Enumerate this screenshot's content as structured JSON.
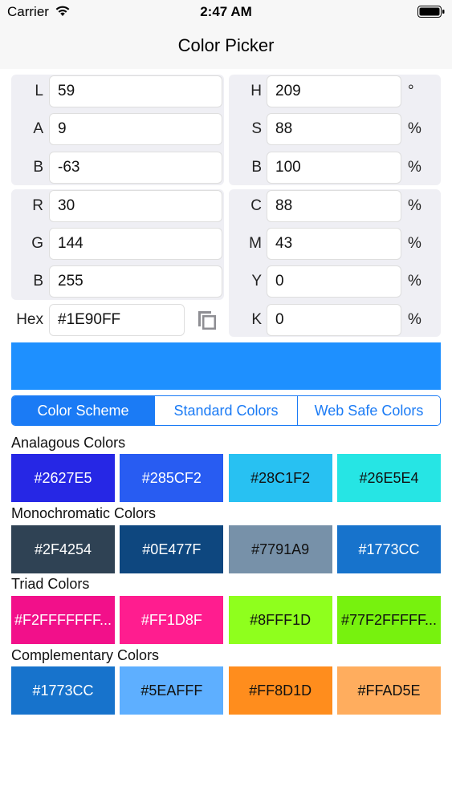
{
  "status_bar": {
    "carrier": "Carrier",
    "time": "2:47 AM"
  },
  "nav": {
    "title": "Color Picker"
  },
  "lab": {
    "l_label": "L",
    "l": "59",
    "a_label": "A",
    "a": "9",
    "b_label": "B",
    "b": "-63"
  },
  "hsb": {
    "h_label": "H",
    "h": "209",
    "h_unit": "°",
    "s_label": "S",
    "s": "88",
    "s_unit": "%",
    "b_label": "B",
    "b": "100",
    "b_unit": "%"
  },
  "rgb": {
    "r_label": "R",
    "r": "30",
    "g_label": "G",
    "g": "144",
    "b_label": "B",
    "b": "255",
    "hex_label": "Hex",
    "hex": "#1E90FF"
  },
  "cmyk": {
    "c_label": "C",
    "c": "88",
    "c_unit": "%",
    "m_label": "M",
    "m": "43",
    "m_unit": "%",
    "y_label": "Y",
    "y": "0",
    "y_unit": "%",
    "k_label": "K",
    "k": "0",
    "k_unit": "%"
  },
  "preview": {
    "color": "#1E90FF"
  },
  "tabs": [
    {
      "label": "Color Scheme",
      "active": true
    },
    {
      "label": "Standard Colors",
      "active": false
    },
    {
      "label": "Web Safe Colors",
      "active": false
    }
  ],
  "sections": [
    {
      "title": "Analagous Colors",
      "swatches": [
        {
          "label": "#2627E5",
          "color": "#2627E5",
          "text_color": "#ffffff"
        },
        {
          "label": "#285CF2",
          "color": "#285CF2",
          "text_color": "#ffffff"
        },
        {
          "label": "#28C1F2",
          "color": "#28C1F2",
          "text_color": "#111111"
        },
        {
          "label": "#26E5E4",
          "color": "#26E5E4",
          "text_color": "#111111"
        }
      ]
    },
    {
      "title": "Monochromatic Colors",
      "swatches": [
        {
          "label": "#2F4254",
          "color": "#2F4254",
          "text_color": "#ffffff"
        },
        {
          "label": "#0E477F",
          "color": "#0E477F",
          "text_color": "#ffffff"
        },
        {
          "label": "#7791A9",
          "color": "#7791A9",
          "text_color": "#111111"
        },
        {
          "label": "#1773CC",
          "color": "#1773CC",
          "text_color": "#ffffff"
        }
      ]
    },
    {
      "title": "Triad Colors",
      "swatches": [
        {
          "label": "#F2FFFFFFF...",
          "color": "#F2108A",
          "text_color": "#ffffff"
        },
        {
          "label": "#FF1D8F",
          "color": "#FF1D8F",
          "text_color": "#ffffff"
        },
        {
          "label": "#8FFF1D",
          "color": "#8FFF1D",
          "text_color": "#111111"
        },
        {
          "label": "#77F2FFFFF...",
          "color": "#77F20E",
          "text_color": "#111111"
        }
      ]
    },
    {
      "title": "Complementary Colors",
      "swatches": [
        {
          "label": "#1773CC",
          "color": "#1773CC",
          "text_color": "#ffffff"
        },
        {
          "label": "#5EAFFF",
          "color": "#5EAFFF",
          "text_color": "#111111"
        },
        {
          "label": "#FF8D1D",
          "color": "#FF8D1D",
          "text_color": "#111111"
        },
        {
          "label": "#FFAD5E",
          "color": "#FFAD5E",
          "text_color": "#111111"
        }
      ]
    }
  ],
  "icons": {
    "wifi": "wifi-icon",
    "battery": "battery-icon",
    "copy": "copy-icon"
  }
}
